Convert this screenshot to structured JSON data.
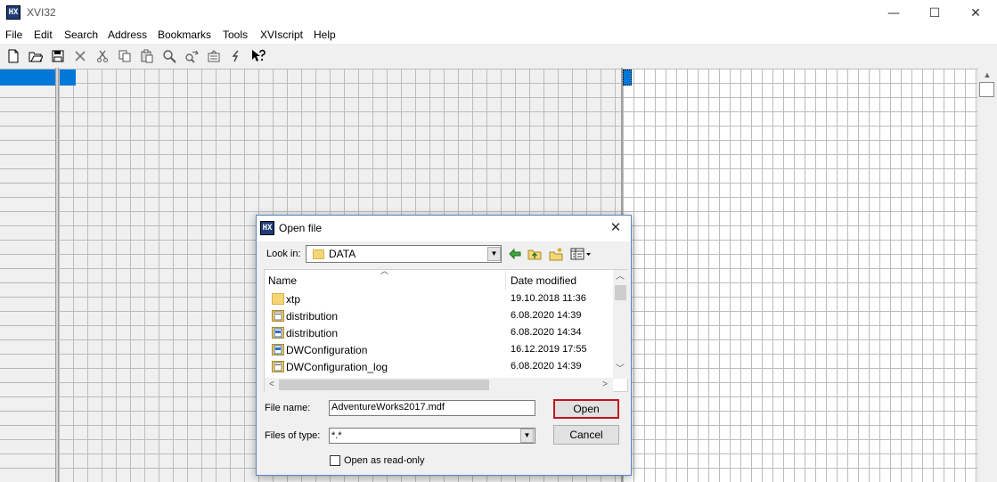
{
  "window": {
    "title": "XVI32",
    "minimize_glyph": "—",
    "maximize_glyph": "☐",
    "close_glyph": "✕"
  },
  "menu": [
    {
      "label": "File"
    },
    {
      "label": "Edit"
    },
    {
      "label": "Search"
    },
    {
      "label": "Address"
    },
    {
      "label": "Bookmarks"
    },
    {
      "label": "Tools"
    },
    {
      "label": "XVIscript"
    },
    {
      "label": "Help"
    }
  ],
  "toolbar": [
    {
      "icon": "new-file-icon"
    },
    {
      "icon": "open-folder-icon"
    },
    {
      "icon": "save-icon"
    },
    {
      "icon": "close-file-icon"
    },
    {
      "icon": "cut-icon"
    },
    {
      "icon": "copy-icon"
    },
    {
      "icon": "paste-icon"
    },
    {
      "icon": "find-icon"
    },
    {
      "icon": "replace-icon"
    },
    {
      "icon": "settings-icon"
    },
    {
      "icon": "script-icon"
    },
    {
      "icon": "context-help-icon"
    }
  ],
  "dialog": {
    "title": "Open file",
    "close_glyph": "✕",
    "look_in_label": "Look in:",
    "look_in_value": "DATA",
    "columns": {
      "name": "Name",
      "date": "Date modified"
    },
    "files": [
      {
        "name": "xtp",
        "date": "19.10.2018 11:36",
        "icon": "folder-icon"
      },
      {
        "name": "distribution",
        "date": "6.08.2020 14:39",
        "icon": "database-file-icon"
      },
      {
        "name": "distribution",
        "date": "6.08.2020 14:34",
        "icon": "database-log-icon"
      },
      {
        "name": "DWConfiguration",
        "date": "16.12.2019 17:55",
        "icon": "database-log-icon"
      },
      {
        "name": "DWConfiguration_log",
        "date": "6.08.2020 14:39",
        "icon": "database-file-icon"
      }
    ],
    "file_name_label": "File name:",
    "file_name_value": "AdventureWorks2017.mdf",
    "files_of_type_label": "Files of type:",
    "files_of_type_value": "*.*",
    "open_button": "Open",
    "cancel_button": "Cancel",
    "read_only_label": "Open as read-only",
    "read_only_checked": false
  },
  "colors": {
    "selection": "#0078d7",
    "dialog_border": "#5a86c2",
    "default_button_border": "#c0141d"
  }
}
